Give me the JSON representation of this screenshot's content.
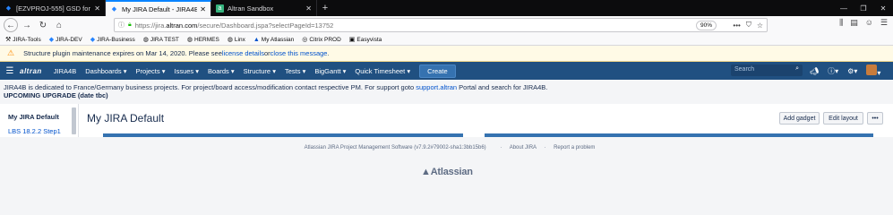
{
  "browser": {
    "tabs": [
      {
        "title": "[EZVPROJ-555] GSD for India -",
        "icon": "jira-diamond-icon"
      },
      {
        "title": "My JIRA Default - JIRA4B",
        "icon": "jira-diamond-icon"
      },
      {
        "title": "Altran Sandbox",
        "icon": "sandbox-icon"
      }
    ],
    "url_prefix": "https://jira.",
    "url_domain": "altran.com",
    "url_path": "/secure/Dashboard.jspa?selectPageId=13752",
    "zoom": "90%",
    "bookmarks": [
      "JIRA-Tools",
      "JIRA-DEV",
      "JIRA-Business",
      "JIRA TEST",
      "HERMES",
      "Linx",
      "My Atlassian",
      "Citrix PROD",
      "Easyvista"
    ]
  },
  "banner": {
    "text_before": "Structure plugin maintenance expires on Mar 14, 2020. Please see ",
    "link1": "license details",
    "text_mid": " or ",
    "link2": "close this message",
    "text_after": "."
  },
  "header": {
    "logo": "altran",
    "menus": [
      "JIRA4B",
      "Dashboards",
      "Projects",
      "Issues",
      "Boards",
      "Structure",
      "Tests",
      "BigGantt",
      "Quick Timesheet"
    ],
    "create": "Create",
    "search_placeholder": "Search"
  },
  "info": {
    "line1_before": "JIRA4B is dedicated to France/Germany business projects. For project/board access/modification contact respective PM. For support goto ",
    "line1_link": "support.altran",
    "line1_after": " Portal and search for JIRA4B.",
    "line2": "UPCOMING UPGRADE (date tbc)"
  },
  "dashboard": {
    "sidebar_current": "My JIRA Default",
    "sidebar_link": "LBS 18.2.2 Step1",
    "title": "My JIRA Default",
    "add_gadget": "Add gadget",
    "edit_layout": "Edit layout",
    "more": "•••"
  },
  "footer": {
    "software": "Atlassian JIRA Project Management Software (v7.9.2#79002-sha1:3bb15b6)",
    "about": "About JIRA",
    "report": "Report a problem",
    "logo": "Atlassian"
  },
  "colors": {
    "jira_header": "#205081",
    "link": "#0052cc",
    "banner_bg": "#fffae6",
    "create_button": "#3572b0"
  }
}
